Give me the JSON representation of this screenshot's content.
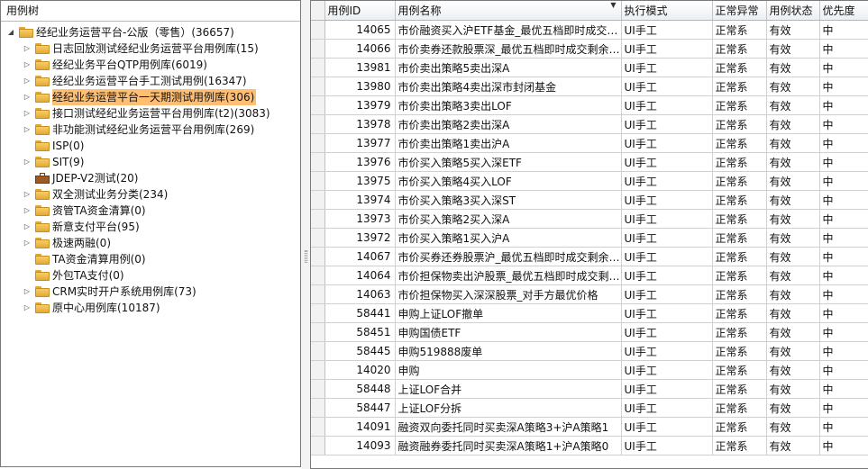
{
  "tree": {
    "title": "用例树",
    "root": "经纪业务运营平台-公版（零售）(36657)",
    "items": [
      {
        "label": "日志回放测试经纪业务运营平台用例库(15)",
        "icon": "folder",
        "expandable": true,
        "selected": false
      },
      {
        "label": "经纪业务平台QTP用例库(6019)",
        "icon": "folder",
        "expandable": true,
        "selected": false
      },
      {
        "label": "经纪业务运营平台手工测试用例(16347)",
        "icon": "folder",
        "expandable": true,
        "selected": false
      },
      {
        "label": "经纪业务运营平台一天期测试用例库(306)",
        "icon": "folder",
        "expandable": true,
        "selected": true
      },
      {
        "label": "接口测试经纪业务运营平台用例库(t2)(3083)",
        "icon": "folder",
        "expandable": true,
        "selected": false
      },
      {
        "label": "非功能测试经纪业务运营平台用例库(269)",
        "icon": "folder",
        "expandable": true,
        "selected": false
      },
      {
        "label": "ISP(0)",
        "icon": "folder",
        "expandable": false,
        "selected": false
      },
      {
        "label": "SIT(9)",
        "icon": "folder",
        "expandable": true,
        "selected": false
      },
      {
        "label": "JDEP-V2测试(20)",
        "icon": "briefcase",
        "expandable": false,
        "selected": false
      },
      {
        "label": "双全测试业务分类(234)",
        "icon": "folder",
        "expandable": true,
        "selected": false
      },
      {
        "label": "资管TA资金清算(0)",
        "icon": "folder",
        "expandable": true,
        "selected": false
      },
      {
        "label": "新意支付平台(95)",
        "icon": "folder",
        "expandable": true,
        "selected": false
      },
      {
        "label": "极速两融(0)",
        "icon": "folder",
        "expandable": true,
        "selected": false
      },
      {
        "label": "TA资金清算用例(0)",
        "icon": "folder",
        "expandable": false,
        "selected": false
      },
      {
        "label": "外包TA支付(0)",
        "icon": "folder",
        "expandable": false,
        "selected": false
      },
      {
        "label": "CRM实时开户系统用例库(73)",
        "icon": "folder",
        "expandable": true,
        "selected": false
      },
      {
        "label": "原中心用例库(10187)",
        "icon": "folder",
        "expandable": true,
        "selected": false
      }
    ]
  },
  "grid": {
    "columns": [
      "用例ID",
      "用例名称",
      "执行模式",
      "正常异常",
      "用例状态",
      "优先度"
    ],
    "rows": [
      [
        "14065",
        "市价融资买入沪ETF基金_最优五档即时成交剩余转限价",
        "UI手工",
        "正常系",
        "有效",
        "中"
      ],
      [
        "14066",
        "市价卖券还款股票深_最优五档即时成交剩余撤销",
        "UI手工",
        "正常系",
        "有效",
        "中"
      ],
      [
        "13981",
        "市价卖出策略5卖出深A",
        "UI手工",
        "正常系",
        "有效",
        "中"
      ],
      [
        "13980",
        "市价卖出策略4卖出深市封闭基金",
        "UI手工",
        "正常系",
        "有效",
        "中"
      ],
      [
        "13979",
        "市价卖出策略3卖出LOF",
        "UI手工",
        "正常系",
        "有效",
        "中"
      ],
      [
        "13978",
        "市价卖出策略2卖出深A",
        "UI手工",
        "正常系",
        "有效",
        "中"
      ],
      [
        "13977",
        "市价卖出策略1卖出沪A",
        "UI手工",
        "正常系",
        "有效",
        "中"
      ],
      [
        "13976",
        "市价买入策略5买入深ETF",
        "UI手工",
        "正常系",
        "有效",
        "中"
      ],
      [
        "13975",
        "市价买入策略4买入LOF",
        "UI手工",
        "正常系",
        "有效",
        "中"
      ],
      [
        "13974",
        "市价买入策略3买入深ST",
        "UI手工",
        "正常系",
        "有效",
        "中"
      ],
      [
        "13973",
        "市价买入策略2买入深A",
        "UI手工",
        "正常系",
        "有效",
        "中"
      ],
      [
        "13972",
        "市价买入策略1买入沪A",
        "UI手工",
        "正常系",
        "有效",
        "中"
      ],
      [
        "14067",
        "市价买券还券股票沪_最优五档即时成交剩余撤销",
        "UI手工",
        "正常系",
        "有效",
        "中"
      ],
      [
        "14064",
        "市价担保物卖出沪股票_最优五档即时成交剩余转限价",
        "UI手工",
        "正常系",
        "有效",
        "中"
      ],
      [
        "14063",
        "市价担保物买入深深股票_对手方最优价格",
        "UI手工",
        "正常系",
        "有效",
        "中"
      ],
      [
        "58441",
        "申购上证LOF撤单",
        "UI手工",
        "正常系",
        "有效",
        "中"
      ],
      [
        "58451",
        "申购国债ETF",
        "UI手工",
        "正常系",
        "有效",
        "中"
      ],
      [
        "58445",
        "申购519888废单",
        "UI手工",
        "正常系",
        "有效",
        "中"
      ],
      [
        "14020",
        "申购",
        "UI手工",
        "正常系",
        "有效",
        "中"
      ],
      [
        "58448",
        "上证LOF合并",
        "UI手工",
        "正常系",
        "有效",
        "中"
      ],
      [
        "58447",
        "上证LOF分拆",
        "UI手工",
        "正常系",
        "有效",
        "中"
      ],
      [
        "14091",
        "融资双向委托同时买卖深A策略3+沪A策略1",
        "UI手工",
        "正常系",
        "有效",
        "中"
      ],
      [
        "14093",
        "融资融券委托同时买卖深A策略1+沪A策略0",
        "UI手工",
        "正常系",
        "有效",
        "中"
      ]
    ]
  }
}
